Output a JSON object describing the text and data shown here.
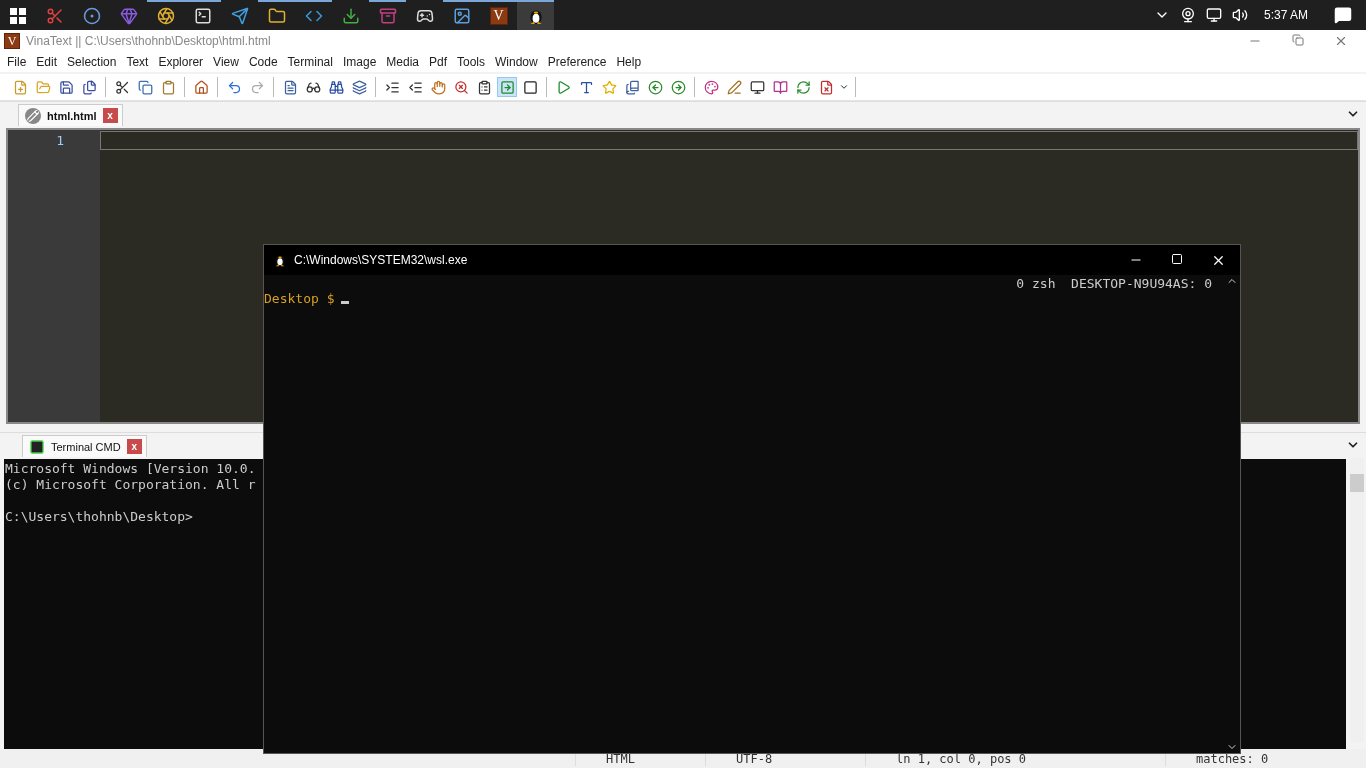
{
  "taskbar": {
    "apps": [
      {
        "selected": false,
        "open": false
      },
      {
        "selected": false,
        "open": false
      },
      {
        "selected": false,
        "open": false
      },
      {
        "selected": false,
        "open": true
      },
      {
        "selected": false,
        "open": true
      },
      {
        "selected": false,
        "open": false
      },
      {
        "selected": false,
        "open": true
      },
      {
        "selected": false,
        "open": true
      },
      {
        "selected": false,
        "open": false
      },
      {
        "selected": false,
        "open": true
      },
      {
        "selected": false,
        "open": false
      },
      {
        "selected": false,
        "open": true
      },
      {
        "selected": false,
        "open": true,
        "label": "V"
      },
      {
        "selected": true,
        "open": true
      }
    ],
    "clock": "5:37 AM"
  },
  "window": {
    "logo": "V",
    "title": "VinaText || C:\\Users\\thohnb\\Desktop\\html.html"
  },
  "menu": [
    "File",
    "Edit",
    "Selection",
    "Text",
    "Explorer",
    "View",
    "Code",
    "Terminal",
    "Image",
    "Media",
    "Pdf",
    "Tools",
    "Window",
    "Preference",
    "Help"
  ],
  "editor": {
    "tabs": [
      {
        "label": "html.html",
        "selected": true,
        "close": "x"
      }
    ],
    "line_numbers": [
      "1"
    ]
  },
  "terminal_panel": {
    "tabs": [
      {
        "label": "Terminal CMD",
        "selected": true,
        "close": "x"
      }
    ],
    "lines": [
      "Microsoft Windows [Version 10.0.",
      "(c) Microsoft Corporation. All r"
    ],
    "prompt": "C:\\Users\\thohnb\\Desktop>"
  },
  "status_bar": [
    "HTML",
    "UTF-8",
    "ln 1, col 0, pos 0",
    "matches: 0"
  ],
  "console_window": {
    "title": "C:\\Windows\\SYSTEM32\\wsl.exe",
    "status": "0 zsh  DESKTOP-N9U94AS: 0",
    "prompt_dir": "Desktop",
    "prompt_sign": "$"
  }
}
